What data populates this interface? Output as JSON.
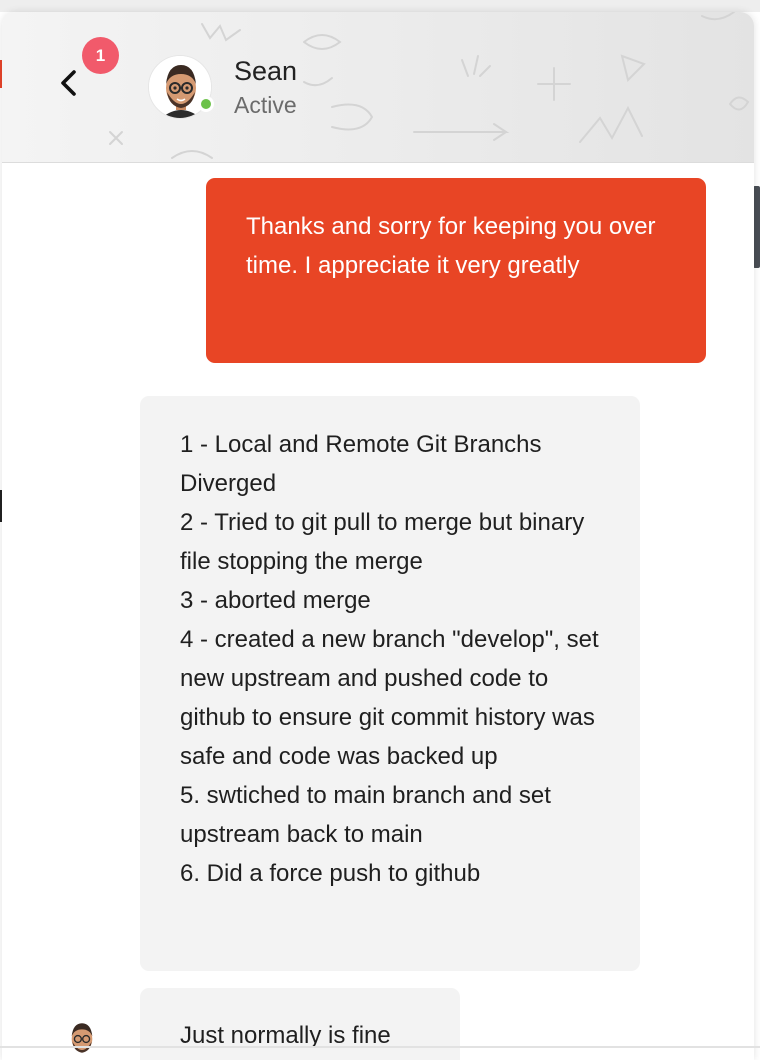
{
  "header": {
    "unread_count": "1",
    "contact_name": "Sean",
    "contact_status": "Active",
    "status_color": "#6cc24a"
  },
  "messages": [
    {
      "direction": "outgoing",
      "text": "Thanks and sorry for keeping you over time. I appreciate it very greatly"
    },
    {
      "direction": "incoming",
      "text": "1 - Local and Remote Git Branchs Diverged\n2 - Tried to git pull to merge but binary file stopping the merge\n3 - aborted merge\n4 - created a new branch \"develop\", set new upstream and pushed code to github to ensure git commit history was safe and code was backed up\n5. swtiched to main branch and set upstream back to main\n6. Did a force push to github"
    },
    {
      "direction": "incoming",
      "text": "Just normally is fine"
    }
  ],
  "colors": {
    "accent": "#e84525",
    "badge": "#f15a6b",
    "incoming_bubble": "#f3f3f3"
  },
  "icons": {
    "back": "chevron-left-icon",
    "avatar": "bitmoji-avatar"
  }
}
